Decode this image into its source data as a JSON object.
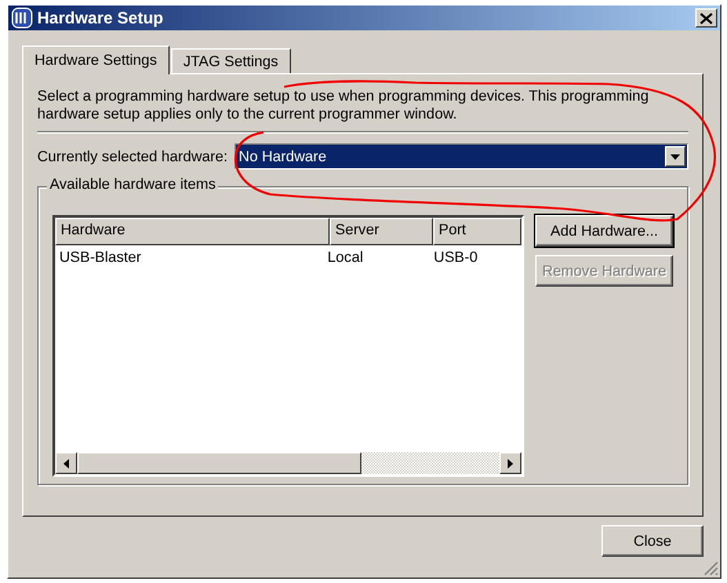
{
  "window": {
    "title": "Hardware Setup"
  },
  "tabs": [
    {
      "label": "Hardware Settings",
      "selected": true
    },
    {
      "label": "JTAG Settings",
      "selected": false
    }
  ],
  "description": "Select a programming hardware setup to use when programming devices. This programming hardware setup applies only to the current programmer window.",
  "hardware_select": {
    "label": "Currently selected hardware:",
    "value": "No Hardware"
  },
  "available": {
    "title": "Available hardware items",
    "columns": [
      "Hardware",
      "Server",
      "Port"
    ],
    "rows": [
      [
        "USB-Blaster",
        "Local",
        "USB-0"
      ]
    ]
  },
  "side_buttons": [
    {
      "label": "Add Hardware...",
      "disabled": false
    },
    {
      "label": "Remove Hardware",
      "disabled": true
    }
  ],
  "buttons": [
    {
      "label": "Close"
    }
  ]
}
